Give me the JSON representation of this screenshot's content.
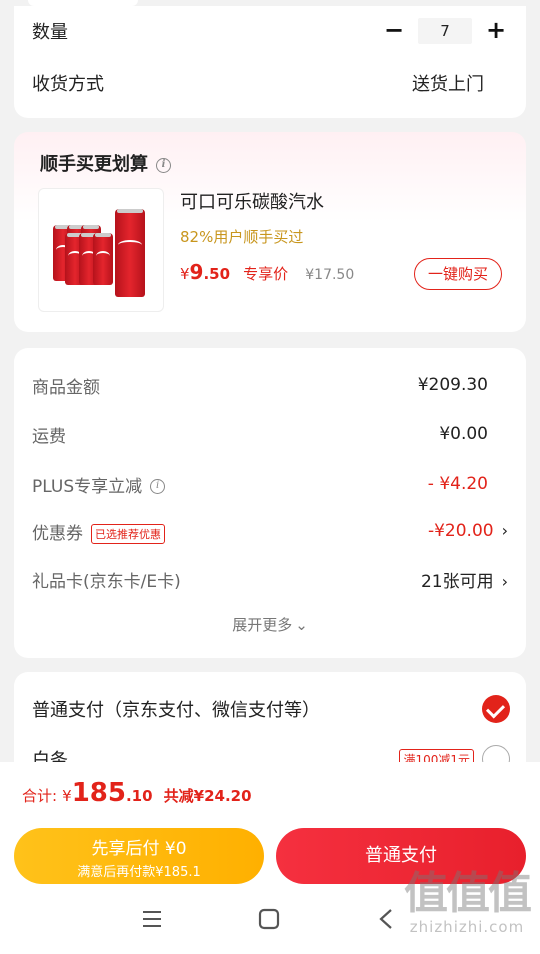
{
  "order": {
    "quantity_label": "数量",
    "quantity_value": "7",
    "minus": "−",
    "plus": "+",
    "delivery_label": "收货方式",
    "delivery_value": "送货上门"
  },
  "cross_sell": {
    "title": "顺手买更划算",
    "product_name": "可口可乐碳酸汽水",
    "popularity": "82%用户顺手买过",
    "price_symbol": "¥",
    "price_int": "9",
    "price_dec": ".50",
    "price_tag": "专享价",
    "original_price": "¥17.50",
    "buy_button": "一键购买"
  },
  "summary": {
    "items": [
      {
        "label": "商品金额",
        "value": "¥209.30"
      },
      {
        "label": "运费",
        "value": "¥0.00"
      },
      {
        "label": "PLUS专享立减",
        "value": "- ¥4.20"
      },
      {
        "label": "优惠券",
        "tag": "已选推荐优惠",
        "value": "-¥20.00"
      },
      {
        "label": "礼品卡(京东卡/E卡)",
        "value": "21张可用"
      }
    ],
    "expand": "展开更多"
  },
  "payment": {
    "normal_label": "普通支付（京东支付、微信支付等）",
    "baitiao_label": "白条",
    "baitiao_promo": "满100减1元"
  },
  "footer": {
    "total_label": "合计:",
    "total_symbol": "¥",
    "total_int": "185",
    "total_dec": ".10",
    "saved": "共减¥24.20",
    "pay_later_title": "先享后付 ¥0",
    "pay_later_sub": "满意后再付款¥185.1",
    "pay_normal": "普通支付"
  },
  "watermark": {
    "cn": "值值值",
    "url": "zhizhizhi.com"
  },
  "colors": {
    "accent_red": "#e2231a",
    "gold": "#c8961e",
    "pay_later_yellow": "#ffb000"
  }
}
